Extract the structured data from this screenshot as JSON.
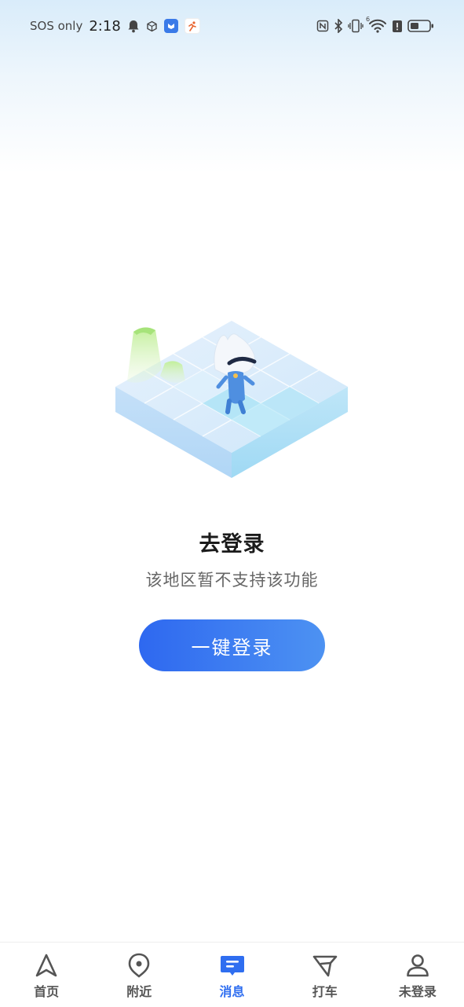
{
  "status_bar": {
    "sos_text": "SOS only",
    "time": "2:18",
    "signal_label": "6"
  },
  "main": {
    "title": "去登录",
    "subtitle": "该地区暂不支持该功能",
    "login_button_label": "一键登录"
  },
  "bottom_nav": {
    "items": [
      {
        "label": "首页",
        "icon": "navigation-arrow-icon"
      },
      {
        "label": "附近",
        "icon": "location-pin-icon"
      },
      {
        "label": "消息",
        "icon": "message-icon"
      },
      {
        "label": "打车",
        "icon": "taxi-flag-icon"
      },
      {
        "label": "未登录",
        "icon": "user-icon"
      }
    ],
    "active_index": 2
  },
  "colors": {
    "accent": "#2f6ef0",
    "button_start": "#2e68f0",
    "button_end": "#4d92f2"
  }
}
